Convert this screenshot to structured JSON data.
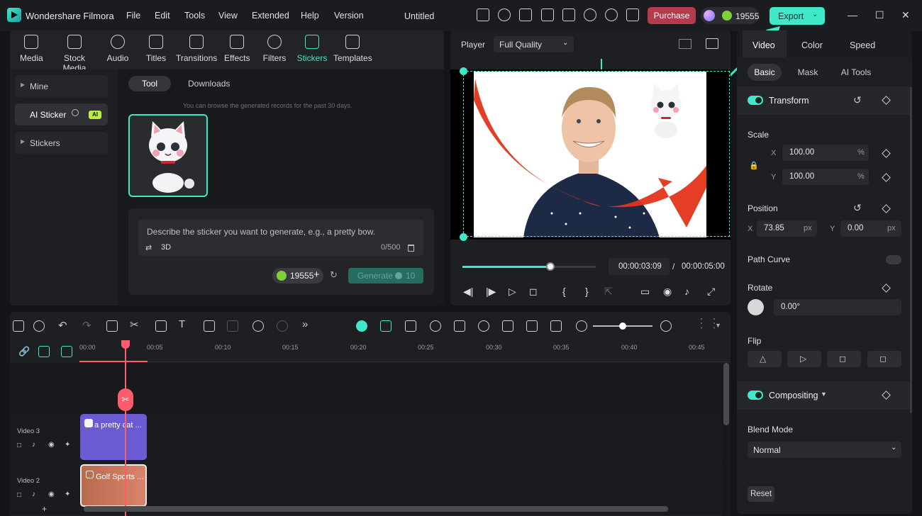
{
  "app": {
    "name": "Wondershare Filmora",
    "doc_title": "Untitled"
  },
  "menu": [
    "File",
    "Edit",
    "Tools",
    "View",
    "Extended",
    "Help",
    "Version"
  ],
  "header": {
    "purchase_label": "Purchase",
    "credits": "19555",
    "export_label": "Export"
  },
  "media_tabs": [
    "Media",
    "Stock Media",
    "Audio",
    "Titles",
    "Transitions",
    "Effects",
    "Filters",
    "Stickers",
    "Templates"
  ],
  "active_media_tab": "Stickers",
  "left_nav": {
    "mine": "Mine",
    "ai_sticker": "AI Sticker",
    "ai_tag": "AI",
    "stickers": "Stickers"
  },
  "sticker_tool": {
    "tab_tool": "Tool",
    "tab_downloads": "Downloads",
    "hint": "You can browse the generated records for the past 30 days.",
    "prompt_placeholder": "Describe the sticker you want to generate, e.g., a pretty bow.",
    "style": "3D",
    "counter": "0/500",
    "credits": "19555",
    "generate_label": "Generate",
    "generate_cost": "10"
  },
  "player": {
    "label": "Player",
    "quality": "Full Quality",
    "current_time": "00:00:03:09",
    "separator": "/",
    "total_time": "00:00:05:00",
    "progress": 0.66
  },
  "right_panel": {
    "tabs": [
      "Video",
      "Color",
      "Speed"
    ],
    "subtabs": [
      "Basic",
      "Mask",
      "AI Tools"
    ],
    "transform": "Transform",
    "scale_label": "Scale",
    "scale_x_label": "X",
    "scale_x": "100.00",
    "scale_y_label": "Y",
    "scale_y": "100.00",
    "percent": "%",
    "position_label": "Position",
    "pos_x_label": "X",
    "pos_x": "73.85",
    "pos_y_label": "Y",
    "pos_y": "0.00",
    "px": "px",
    "path_curve": "Path Curve",
    "rotate_label": "Rotate",
    "rotate_value": "0.00°",
    "flip_label": "Flip",
    "compositing": "Compositing",
    "blend_label": "Blend Mode",
    "blend_value": "Normal",
    "reset_label": "Reset"
  },
  "timeline": {
    "ticks": [
      "00:00",
      "00:05",
      "00:10",
      "00:15",
      "00:20",
      "00:25",
      "00:30",
      "00:35",
      "00:40",
      "00:45"
    ],
    "tracks": [
      {
        "name": "Video 3",
        "clip": "a pretty cat ..."
      },
      {
        "name": "Video 2",
        "clip": "Golf Sports ..."
      }
    ]
  },
  "colors": {
    "accent": "#3ee8c8",
    "purchase": "#b53a4e",
    "playhead": "#ff5d6b",
    "clip_video3": "#6b5bd2"
  }
}
